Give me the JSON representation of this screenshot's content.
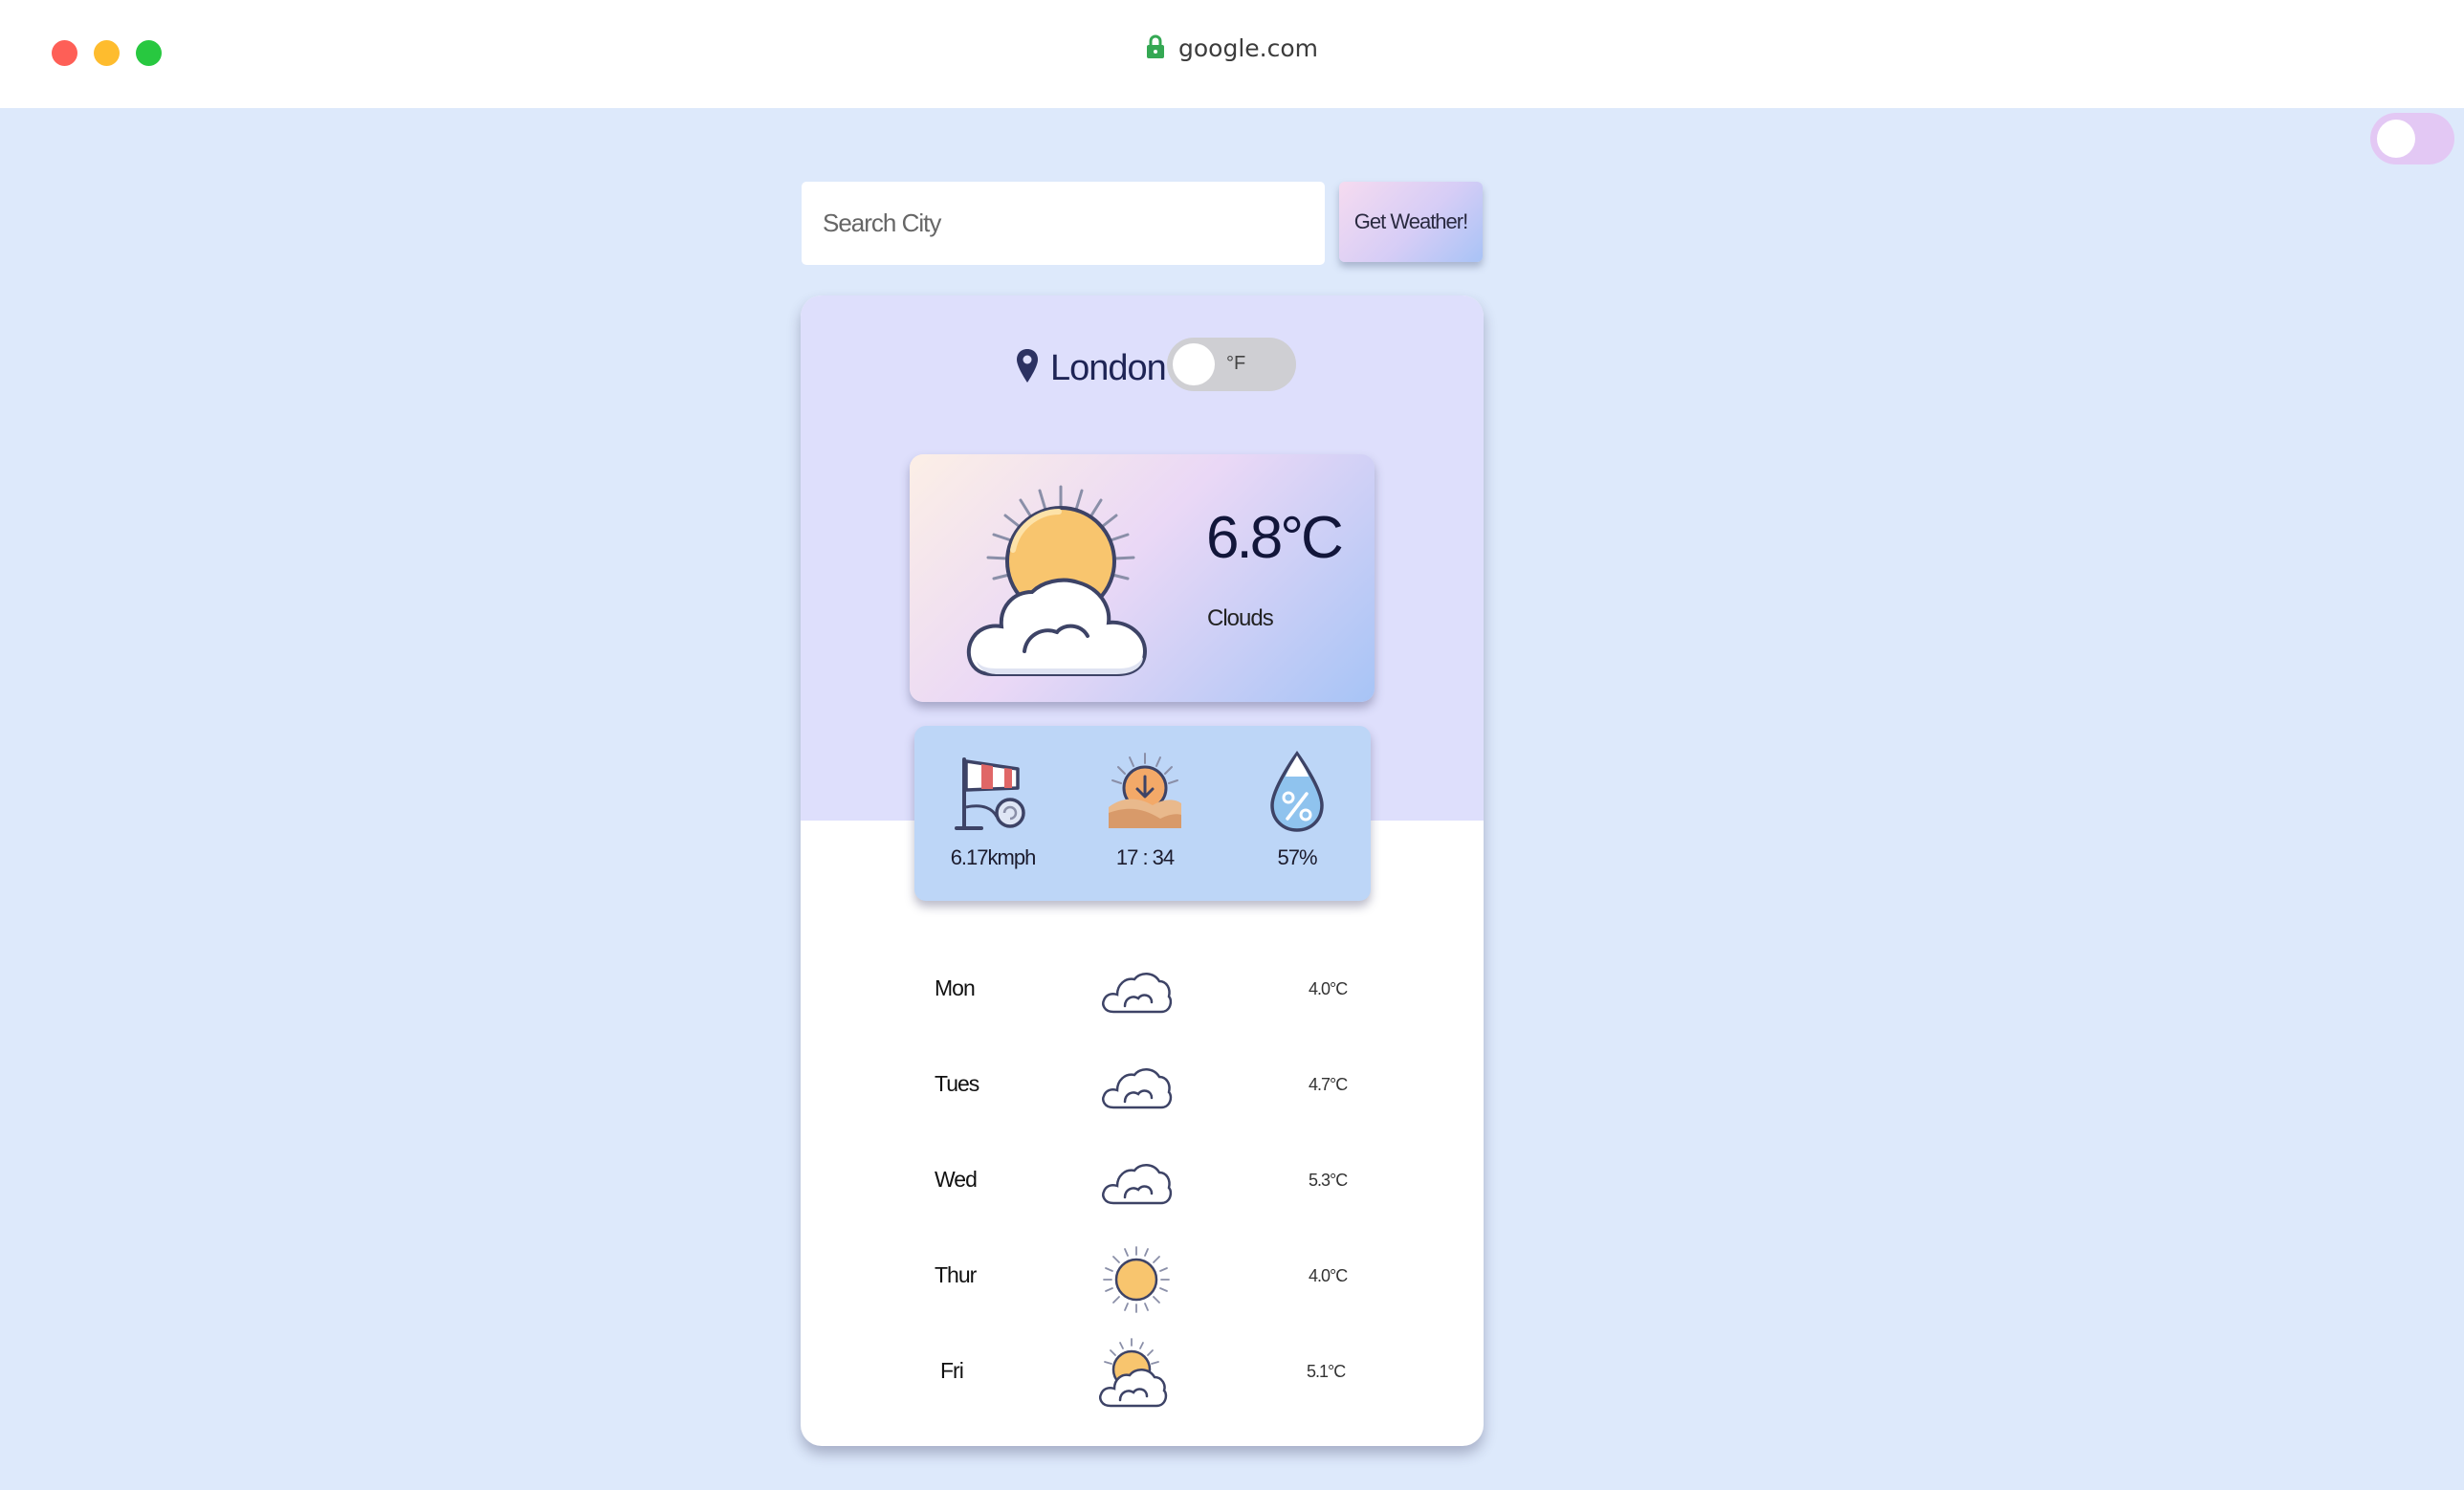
{
  "browser": {
    "url": "google.com",
    "icons": [
      "lock-icon"
    ]
  },
  "search": {
    "placeholder": "Search City",
    "value": "",
    "button_label": "Get Weather!"
  },
  "location": {
    "city": "London",
    "unit_toggle_label": "°F",
    "icon": "map-pin-icon"
  },
  "current": {
    "temperature": "6.8°C",
    "description": "Clouds",
    "icon": "sun-behind-cloud-icon"
  },
  "stats": [
    {
      "icon": "windsock-icon",
      "value": "6.17kmph"
    },
    {
      "icon": "sunset-icon",
      "value": "17 : 34"
    },
    {
      "icon": "humidity-drop-icon",
      "value": "57%"
    }
  ],
  "forecast": [
    {
      "day": "Mon",
      "icon": "cloud-icon",
      "temp": "4.0°C"
    },
    {
      "day": "Tues",
      "icon": "cloud-icon",
      "temp": "4.7°C"
    },
    {
      "day": "Wed",
      "icon": "cloud-icon",
      "temp": "5.3°C"
    },
    {
      "day": "Thur",
      "icon": "sun-icon",
      "temp": "4.0°C"
    },
    {
      "day": "Fri",
      "icon": "sun-behind-cloud-icon",
      "temp": "5.1°C"
    }
  ],
  "colors": {
    "page_bg": "#dde9fb",
    "card_top_bg": "#dedffc",
    "stats_bg": "#bdd6f7",
    "theme_toggle": "#e3c8f4",
    "sun": "#f8c56e",
    "outline": "#3d4366"
  }
}
